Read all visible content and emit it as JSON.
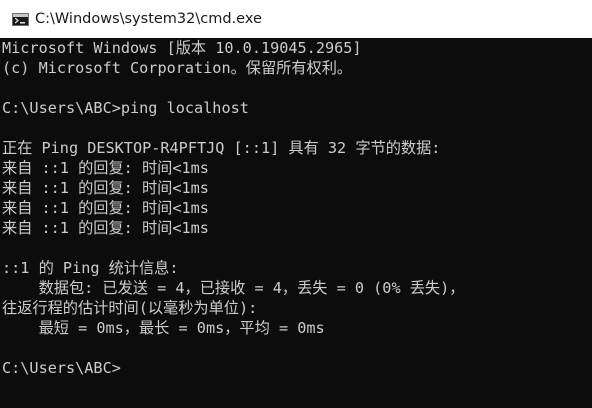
{
  "window": {
    "title": "C:\\Windows\\system32\\cmd.exe",
    "icon": "command-prompt-icon",
    "colors": {
      "titlebar_bg": "#ffffff",
      "console_bg": "#0c0c0c",
      "console_fg": "#cccccc"
    }
  },
  "console": {
    "lines": [
      "Microsoft Windows [版本 10.0.19045.2965]",
      "(c) Microsoft Corporation。保留所有权利。",
      "",
      "C:\\Users\\ABC>ping localhost",
      "",
      "正在 Ping DESKTOP-R4PFTJQ [::1] 具有 32 字节的数据:",
      "来自 ::1 的回复: 时间<1ms",
      "来自 ::1 的回复: 时间<1ms",
      "来自 ::1 的回复: 时间<1ms",
      "来自 ::1 的回复: 时间<1ms",
      "",
      "::1 的 Ping 统计信息:",
      "    数据包: 已发送 = 4，已接收 = 4，丢失 = 0 (0% 丢失)，",
      "往返行程的估计时间(以毫秒为单位):",
      "    最短 = 0ms，最长 = 0ms，平均 = 0ms",
      "",
      "C:\\Users\\ABC>"
    ]
  }
}
